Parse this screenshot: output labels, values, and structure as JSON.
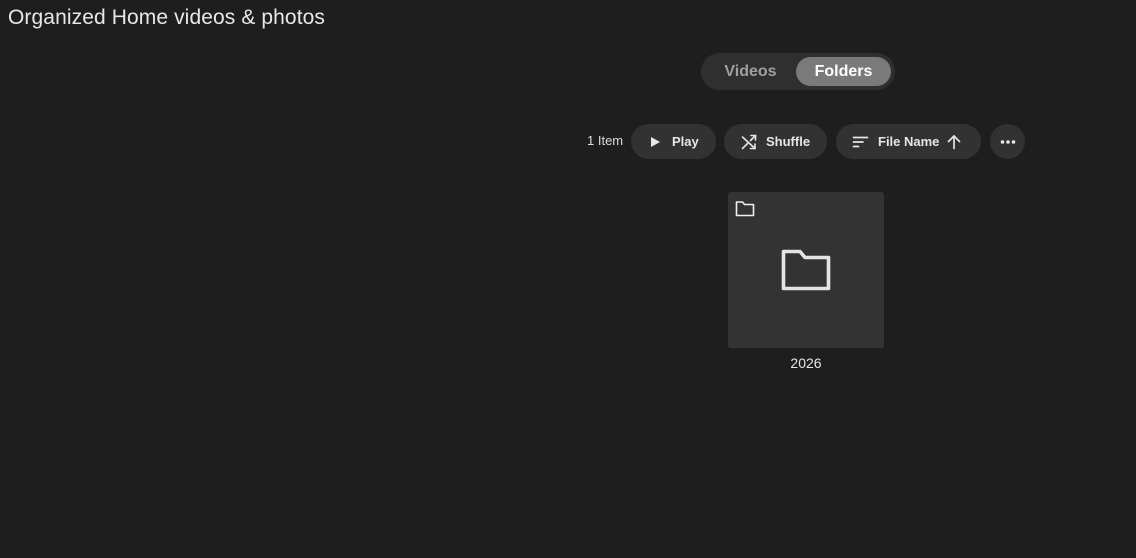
{
  "page": {
    "title": "Organized Home videos & photos"
  },
  "tabs": [
    {
      "label": "Videos",
      "selected": false
    },
    {
      "label": "Folders",
      "selected": true
    }
  ],
  "toolbar": {
    "item_count": "1 Item",
    "play_label": "Play",
    "shuffle_label": "Shuffle",
    "sort_label": "File Name",
    "sort_direction": "ascending",
    "play_icon": "play-icon",
    "shuffle_icon": "shuffle-icon",
    "sort_icon": "sort-icon",
    "sort_direction_icon": "arrow-up-icon",
    "more_icon": "more-horizontal-icon"
  },
  "items": [
    {
      "name": "2026",
      "type": "folder",
      "icon": "folder-icon"
    }
  ],
  "colors": {
    "background": "#1e1e1e",
    "surface": "#323232",
    "tab_selected": "#7a7a7a",
    "text": "#e6e6e6",
    "text_muted": "#a0a0a0"
  }
}
